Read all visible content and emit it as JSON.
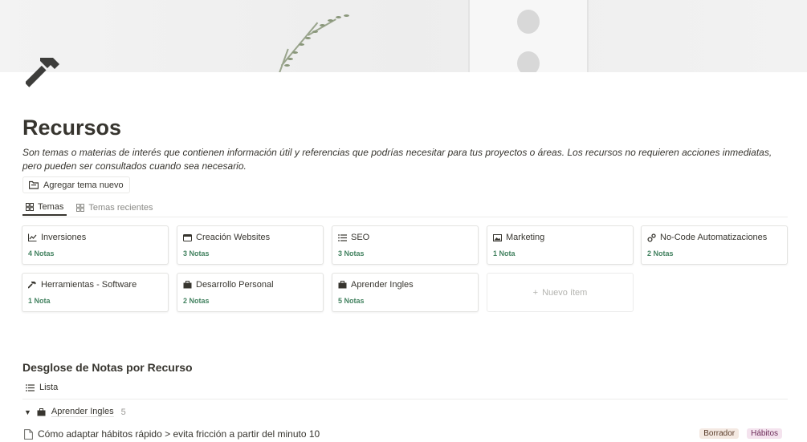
{
  "page": {
    "title": "Recursos",
    "description": "Son temas o materias de interés que contienen información útil y referencias que podrías necesitar para tus proyectos o áreas. Los recursos no requieren acciones inmediatas, pero pueden ser consultados cuando sea necesario.",
    "icon": "hammer-icon"
  },
  "toolbar": {
    "add_label": "Agregar tema nuevo"
  },
  "tabs": [
    {
      "label": "Temas",
      "icon": "gallery-icon",
      "active": true
    },
    {
      "label": "Temas recientes",
      "icon": "gallery-icon",
      "active": false
    }
  ],
  "cards": [
    {
      "name": "Inversiones",
      "icon": "chart-line-icon",
      "count": "4 Notas"
    },
    {
      "name": "Creación Websites",
      "icon": "browser-window-icon",
      "count": "3 Notas"
    },
    {
      "name": "SEO",
      "icon": "list-icon",
      "count": "3 Notas"
    },
    {
      "name": "Marketing",
      "icon": "image-icon",
      "count": "1 Nota"
    },
    {
      "name": "No-Code Automatizaciones",
      "icon": "gears-icon",
      "count": "2 Notas"
    },
    {
      "name": "Herramientas - Software",
      "icon": "hammer-icon",
      "count": "1 Nota"
    },
    {
      "name": "Desarrollo Personal",
      "icon": "briefcase-icon",
      "count": "2 Notas"
    },
    {
      "name": "Aprender Ingles",
      "icon": "briefcase-icon",
      "count": "5 Notas"
    }
  ],
  "new_item_label": "Nuevo ítem",
  "notes_section": {
    "title": "Desglose de Notas por Recurso",
    "view_label": "Lista",
    "group": {
      "name": "Aprender Ingles",
      "count": "5"
    },
    "rows": [
      {
        "title": "Cómo adaptar hábitos rápido > evita fricción a partir del minuto 10",
        "tags": [
          "Borrador",
          "Hábitos"
        ]
      }
    ]
  },
  "colors": {
    "text": "#37352f",
    "count_green": "#448361",
    "muted": "#9b9a97",
    "border": "#e3e3e1"
  }
}
